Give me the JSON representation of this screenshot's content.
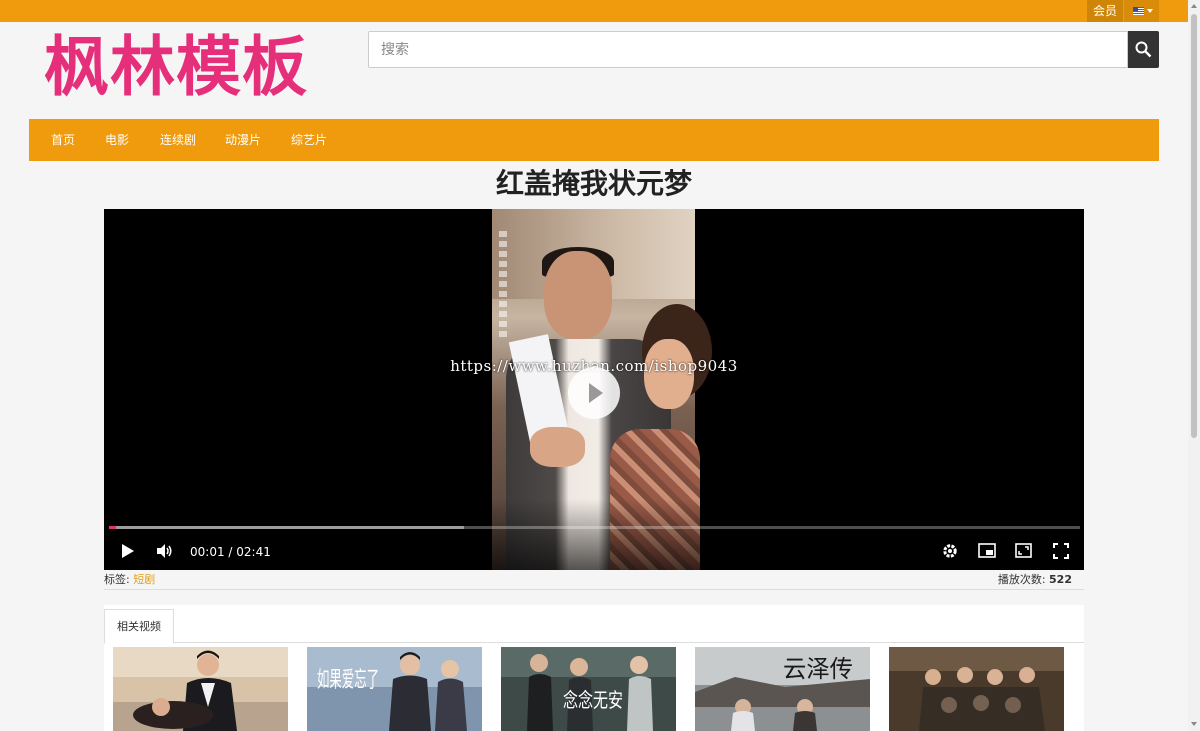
{
  "header": {
    "member_label": "会员",
    "language_icon": "us-flag-icon",
    "logo_text": "枫林模板",
    "search_placeholder": "搜索",
    "search_icon": "search-icon"
  },
  "nav": {
    "items": [
      {
        "label": "首页"
      },
      {
        "label": "电影"
      },
      {
        "label": "连续剧"
      },
      {
        "label": "动漫片"
      },
      {
        "label": "综艺片"
      }
    ]
  },
  "video": {
    "title": "红盖掩我状元梦",
    "watermark": "https://www.huzhan.com/ishop9043",
    "current_time": "00:01",
    "duration": "02:41",
    "time_display": "00:01 / 02:41",
    "played_fraction": 0.007,
    "buffered_fraction": 0.366,
    "controls": {
      "play_icon": "play-icon",
      "volume_icon": "volume-icon",
      "settings_icon": "gear-icon",
      "pip_icon": "picture-in-picture-icon",
      "theater_icon": "theater-mode-icon",
      "fullscreen_icon": "fullscreen-icon"
    }
  },
  "meta": {
    "tag_label": "标签: ",
    "tag_value": "短剧",
    "plays_label": "播放次数: ",
    "plays_value": "522"
  },
  "related": {
    "tab_label": "相关视频",
    "thumb_texts": [
      "",
      "如果爱忘了",
      "念念无安",
      "云泽传",
      ""
    ]
  },
  "colors": {
    "accent": "#f09a0e",
    "logo": "#e52f7a",
    "tag": "#e0a020"
  }
}
